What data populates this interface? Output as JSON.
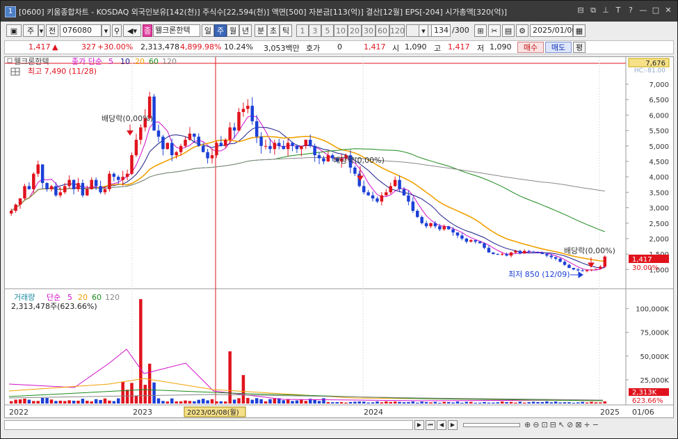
{
  "window": {
    "app_num": "1",
    "title": "[0600] 키움종합차트 - KOSDAQ 외국인보유[142(천)] 주식수[22,594(천)] 액면[500] 자본금[113(억)] 결산[12월] EPS[-204] 시가총액[320(억)]"
  },
  "toolbar": {
    "tab_stock": "주",
    "tab_all": "전",
    "code": "076080",
    "badge": "종",
    "name": "웰크론한텍",
    "periods": [
      "일",
      "주",
      "월",
      "년",
      "분",
      "초",
      "틱"
    ],
    "active_period": "주",
    "numbers": [
      "1",
      "3",
      "5",
      "10",
      "20",
      "30",
      "60",
      "120"
    ],
    "count": "134",
    "count_total": "/300",
    "date": "2025/01/06"
  },
  "quote": {
    "price": "1,417",
    "change": "327",
    "change_pct": "+30.00%",
    "volume": "2,313,478",
    "volume_ratio": "4,899.98%",
    "turnover": "10.24%",
    "amount": "3,053백만",
    "hoga_label": "호가",
    "hoga_value": "0",
    "hoga_price": "1,417",
    "open_label": "시",
    "open": "1,090",
    "high_label": "고",
    "high": "1,417",
    "low_label": "저",
    "low": "1,090",
    "buy": "매수",
    "sell": "매도",
    "eval": "평"
  },
  "price_chart": {
    "legend_name": "웰크론한텍",
    "legend_type": "종가 단순",
    "ma_periods": [
      "5",
      "10",
      "20",
      "60",
      "120"
    ],
    "ma_colors": [
      "#d010c8",
      "#1a1a8a",
      "#f0a000",
      "#1a8a1a",
      "#888888"
    ],
    "high_note": "최고 7,490 (11/28)",
    "low_note": "최저 850 (12/09)",
    "dividend_labels": [
      "배당락(0,00%)",
      "배당락(0,00%)",
      "배당락(0,00%)"
    ],
    "y_top_label": "7,676",
    "y_sub_label": "HC:-81.00",
    "current_price_label": "1,417",
    "current_pct_label": "30.00%",
    "y_ticks": [
      "7,000",
      "6,500",
      "6,000",
      "5,500",
      "5,000",
      "4,500",
      "4,000",
      "3,500",
      "3,000",
      "2,500",
      "2,000",
      "1,500",
      "1,000"
    ]
  },
  "volume_chart": {
    "legend_name": "거래량",
    "legend_type": "단순",
    "ma_periods": [
      "5",
      "20",
      "60",
      "120"
    ],
    "volume_text": "2,313,478주(623.66%)",
    "y_ticks": [
      "100,000K",
      "75,000K",
      "50,000K",
      "25,000K"
    ],
    "current_label": "2,313K",
    "current_pct": "623.66%"
  },
  "x_axis": {
    "labels": [
      "2022",
      "2023",
      "2024",
      "2025"
    ],
    "crosshair_date": "2023/05/08(월)",
    "right_date": "01/06"
  },
  "chart_data": {
    "type": "candlestick",
    "period": "weekly",
    "ylim": [
      850,
      7676
    ],
    "crosshair_date": "2023/05/08",
    "close_approx": [
      2900,
      3100,
      3300,
      3700,
      3600,
      4100,
      4400,
      3800,
      3600,
      3700,
      3400,
      3500,
      3700,
      3900,
      3600,
      3800,
      3400,
      3600,
      3900,
      3700,
      3500,
      3600,
      4100,
      4000,
      3900,
      4000,
      4100,
      4700,
      5200,
      5600,
      5900,
      6600,
      5500,
      5300,
      4900,
      5100,
      4700,
      4800,
      5000,
      5200,
      5400,
      5300,
      5000,
      4800,
      4600,
      4700,
      5100,
      5000,
      5200,
      5600,
      5500,
      6100,
      6200,
      6300,
      5800,
      5300,
      5000,
      5000,
      4900,
      5100,
      5000,
      4900,
      5100,
      5000,
      4900,
      5000,
      5200,
      5000,
      4700,
      4600,
      4500,
      4700,
      4600,
      4500,
      4600,
      4700,
      4300,
      4100,
      3700,
      3500,
      3400,
      3300,
      3200,
      3400,
      3500,
      3700,
      3900,
      3600,
      3400,
      3200,
      2900,
      2700,
      2500,
      2400,
      2500,
      2400,
      2300,
      2400,
      2300,
      2200,
      2100,
      2000,
      1900,
      1950,
      1900,
      1850,
      1700,
      1550,
      1500,
      1480,
      1500,
      1450,
      1550,
      1600,
      1520,
      1600,
      1580,
      1560,
      1540,
      1500,
      1450,
      1400,
      1350,
      1250,
      1150,
      1050,
      1000,
      970,
      950,
      980,
      1000,
      1020,
      1090,
      1417
    ]
  }
}
